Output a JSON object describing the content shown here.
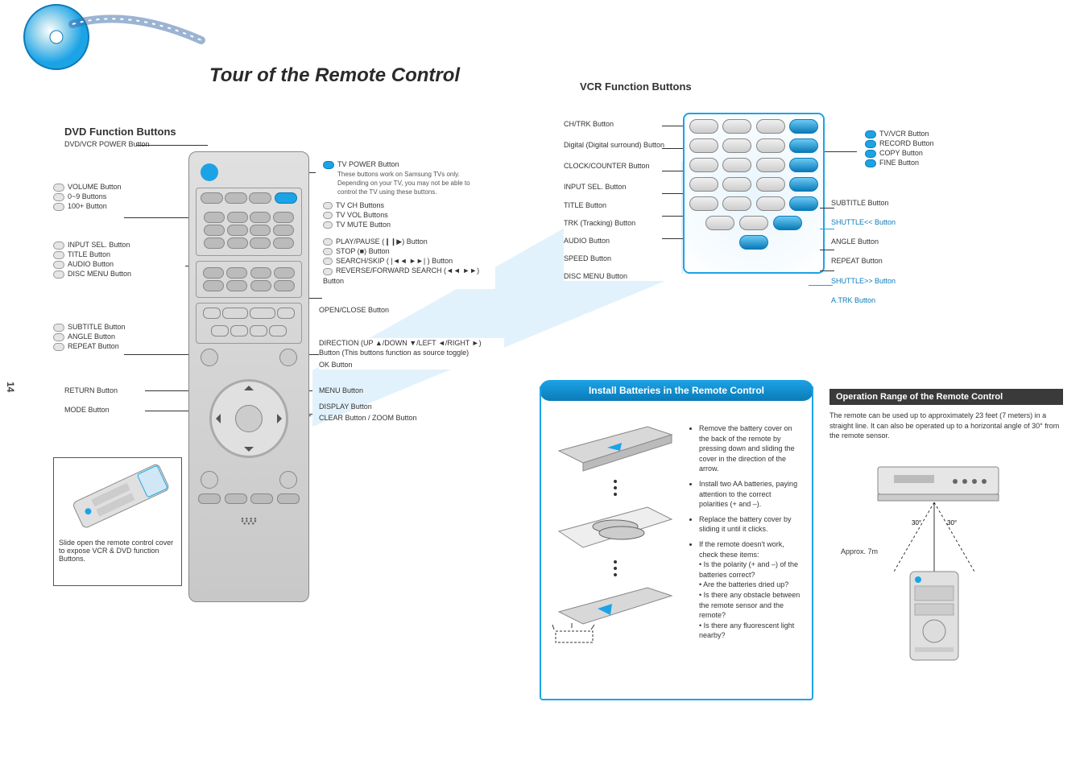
{
  "page": {
    "number": "14",
    "main_title": "Tour of the Remote Control"
  },
  "left_section_title": "DVD Function Buttons",
  "right_section_title": "VCR Function Buttons",
  "labels": {
    "power": "DVD/VCR POWER Button",
    "tv": {
      "text": "These buttons work on Samsung TVs only. Depending on your TV, you may not be able to control the TV using these buttons.",
      "items": [
        "TV POWER Button",
        "TV CH Buttons",
        "TV VOL Buttons",
        "TV MUTE Button"
      ]
    },
    "box1": {
      "items": [
        "VOLUME Button",
        "0~9 Buttons",
        "100+ Button"
      ]
    },
    "box2": {
      "items": [
        "INPUT SEL. Button",
        "TITLE Button",
        "AUDIO Button",
        "DISC MENU Button"
      ]
    },
    "box3": {
      "items": [
        "SUBTITLE Button",
        "ANGLE Button",
        "REPEAT Button"
      ]
    },
    "play_box": {
      "items": [
        "PLAY/PAUSE (❙❙▶) Button",
        "STOP (■) Button",
        "SEARCH/SKIP ( |◄◄  ►►| ) Button",
        "REVERSE/FORWARD SEARCH (◄◄ ►►) Button"
      ]
    },
    "dpad": "DIRECTION (UP ▲/DOWN ▼/LEFT ◄/RIGHT ►) Button (This buttons function as source toggle)",
    "direction_sub": "OK Button",
    "return": "RETURN Button",
    "menu": "MENU Button",
    "mode": "MODE Button",
    "display": "DISPLAY Button",
    "clear_zoom_open": "CLEAR Button / ZOOM Button",
    "open_close": "OPEN/CLOSE Button",
    "zoom": {
      "left": [
        "CH/TRK Button",
        "Digital (Digital surround) Button",
        "CLOCK/COUNTER Button",
        "INPUT SEL. Button",
        "TITLE Button",
        "TRK (Tracking) Button",
        "AUDIO Button",
        "SPEED Button",
        "DISC MENU Button"
      ],
      "right_top": [
        "TV/VCR Button",
        "RECORD Button",
        "COPY Button",
        "FINE Button"
      ],
      "right_mid": [
        "SUBTITLE Button",
        "SHUTTLE<< Button",
        "ANGLE Button",
        "REPEAT Button",
        "SHUTTLE>> Button",
        "A.TRK Button"
      ]
    },
    "mini": "Slide open the remote control cover to expose VCR & DVD function Buttons."
  },
  "battery": {
    "title": "Install Batteries in the Remote Control",
    "steps": [
      "Remove the battery cover on the back of the remote by pressing down and sliding the cover in the direction of the arrow.",
      "Install two AA batteries, paying attention to the correct polarities (+ and –).",
      "Replace the battery cover by sliding it until it clicks.",
      "If the remote doesn't work, check these items:\n• Is the polarity (+ and –) of the batteries correct?\n• Are the batteries dried up?\n• Is there any obstacle between the remote sensor and the remote?\n• Is there any fluorescent light nearby?"
    ]
  },
  "operation": {
    "title": "Operation Range of the Remote Control",
    "text": "The remote can be used up to approximately 23 feet (7 meters) in a straight line. It can also be operated up to a horizontal angle of 30° from the remote sensor.",
    "approx": "Approx. 7m"
  }
}
